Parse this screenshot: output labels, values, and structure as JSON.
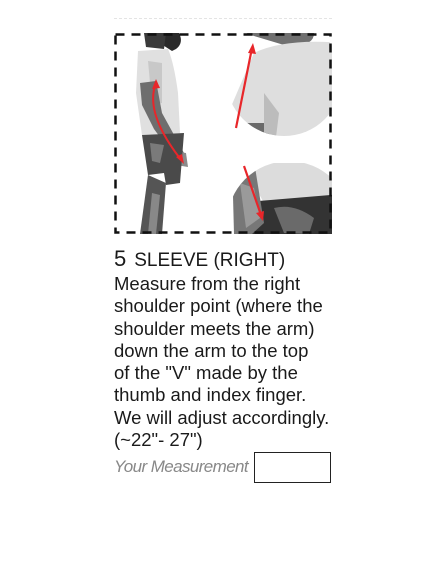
{
  "step": {
    "number": "5",
    "title": "SLEEVE (RIGHT)",
    "instructions": [
      "Measure from the right",
      "shoulder point (where the",
      "shoulder meets the arm)",
      "down the arm to the top",
      "of the \"V\" made by the",
      "thumb and index finger.",
      "We will adjust accordingly.",
      "(~22\"- 27\")"
    ]
  },
  "measurement": {
    "label": "Your Measurement",
    "value": ""
  },
  "colors": {
    "arrow": "#e8262a",
    "dash": "#111111"
  }
}
